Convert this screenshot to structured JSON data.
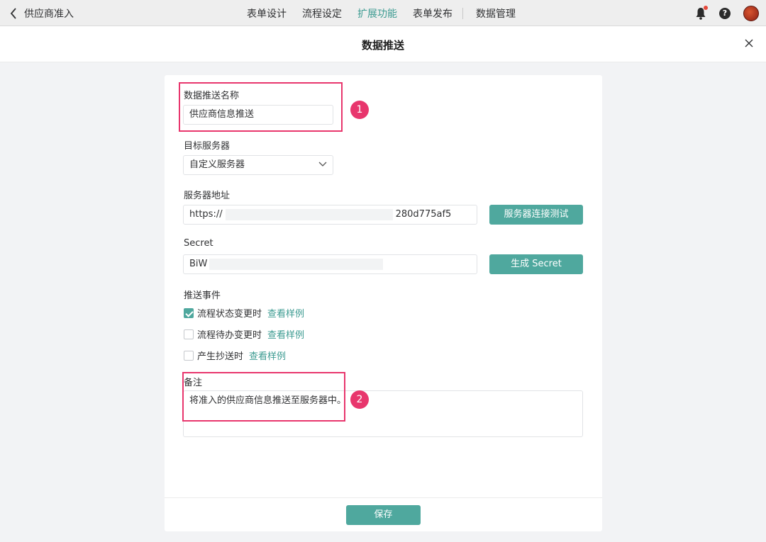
{
  "topbar": {
    "back_label": "供应商准入",
    "nav": [
      "表单设计",
      "流程设定",
      "扩展功能",
      "表单发布",
      "数据管理"
    ],
    "active_index": 2
  },
  "dialog": {
    "title": "数据推送"
  },
  "form": {
    "name_label": "数据推送名称",
    "name_value": "供应商信息推送",
    "server_label": "目标服务器",
    "server_value": "自定义服务器",
    "address_label": "服务器地址",
    "address_prefix": "https://",
    "address_suffix": "280d775af5",
    "test_button": "服务器连接测试",
    "secret_label": "Secret",
    "secret_value": "BiW",
    "secret_button": "生成 Secret",
    "events_label": "推送事件",
    "events": [
      {
        "label": "流程状态变更时",
        "link": "查看样例",
        "checked": true
      },
      {
        "label": "流程待办变更时",
        "link": "查看样例",
        "checked": false
      },
      {
        "label": "产生抄送时",
        "link": "查看样例",
        "checked": false
      }
    ],
    "remark_label": "备注",
    "remark_value": "将准入的供应商信息推送至服务器中。",
    "save_button": "保存"
  },
  "annotations": [
    "1",
    "2"
  ],
  "colors": {
    "accent": "#4fa89e",
    "highlight": "#e8366d"
  }
}
